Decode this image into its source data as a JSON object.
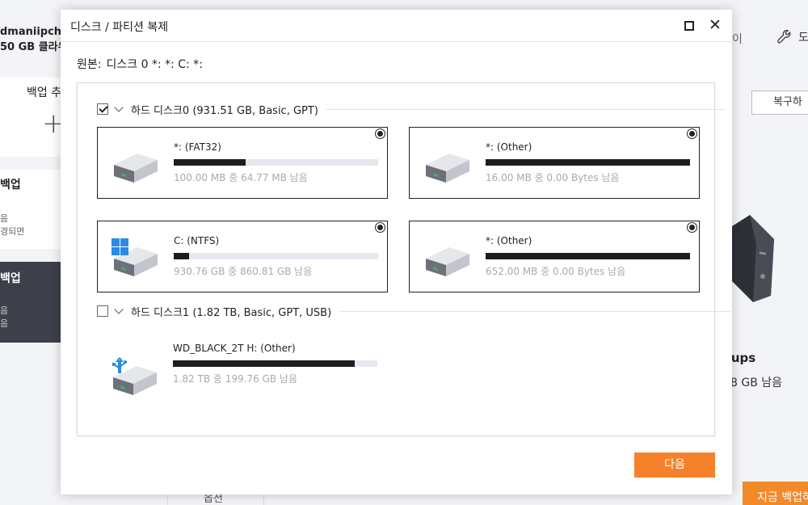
{
  "background": {
    "user_email_fragment": "dmaniipch@",
    "cloud_fragment": "50 GB 클라우",
    "create_backup_fragment": "백업 추",
    "card1_title": "백업",
    "card1_line1": "음",
    "card1_line2": "경되면",
    "card2_title": "백업",
    "card2_line1": "음",
    "card2_line2": "음",
    "header_fragment": "이",
    "tools_fragment": "도",
    "restore_label": "복구하",
    "backups_label": "ckups",
    "backups_size": "8 GB  남음",
    "backup_now_label": "지금 백업하",
    "bottom_label": "옵션"
  },
  "dialog": {
    "title": "디스크 / 파티션 복제",
    "source_label": "원본:",
    "source_value": "디스크 0 *: *: C: *:",
    "next_label": "다음",
    "disks": [
      {
        "name": "하드 디스크0 (931.51 GB, Basic, GPT)",
        "checked": true,
        "partitions": [
          {
            "name": "*: (FAT32)",
            "size_text": "100.00 MB 중 64.77 MB  남음",
            "used_fraction": 0.35,
            "icon": "hdd-icon",
            "selected": true
          },
          {
            "name": "*: (Other)",
            "size_text": "16.00 MB 중 0.00 Bytes  남음",
            "used_fraction": 1.0,
            "icon": "hdd-icon",
            "selected": true
          },
          {
            "name": "C: (NTFS)",
            "size_text": "930.76 GB 중 860.81 GB  남음",
            "used_fraction": 0.075,
            "icon": "windows-hdd-icon",
            "selected": true
          },
          {
            "name": "*: (Other)",
            "size_text": "652.00 MB 중 0.00 Bytes  남음",
            "used_fraction": 1.0,
            "icon": "hdd-icon",
            "selected": true
          }
        ]
      },
      {
        "name": "하드 디스크1 (1.82 TB, Basic, GPT, USB)",
        "checked": false,
        "partitions": [
          {
            "name": "WD_BLACK_2T H: (Other)",
            "size_text": "1.82 TB 중 199.76 GB  남음",
            "used_fraction": 0.89,
            "icon": "usb-hdd-icon",
            "selected": false
          }
        ]
      }
    ]
  },
  "colors": {
    "accent": "#f5822a",
    "bar_fill": "#1d1d1d",
    "bar_track": "#e6e8ef"
  }
}
